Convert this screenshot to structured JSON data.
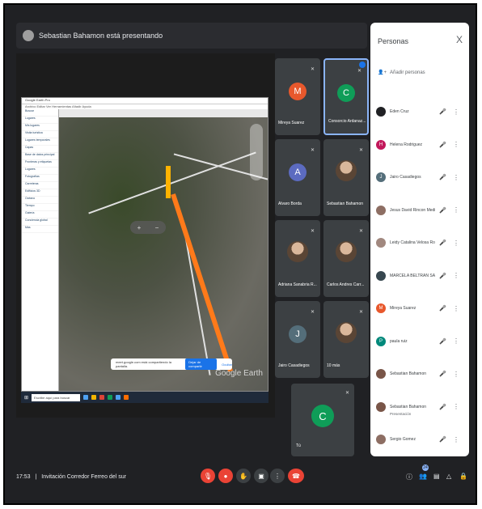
{
  "presenting": {
    "text": "Sebastian Bahamon está presentando"
  },
  "shared_screen": {
    "window_title": "Google Earth Pro",
    "menu": "Archivo  Editar  Ver  Herramientas  Añadir  Ayuda",
    "sidebar_rows": [
      "Buscar",
      "Lugares",
      "Mis lugares",
      "Visita turística",
      "Lugares temporales",
      "Capas",
      "Base de datos principal",
      "Fronteras y etiquetas",
      "Lugares",
      "Fotografías",
      "Carreteras",
      "Edificios 3D",
      "Océano",
      "Tiempo",
      "Galería",
      "Conciencia global",
      "Más"
    ],
    "map_logo": "Google Earth",
    "share_notice": "meet.google.com está compartiendo la pantalla.",
    "stop_share": "Dejar de compartir",
    "hide": "Ocultar",
    "taskbar_search": "Escribe aquí para buscar"
  },
  "tiles": [
    {
      "name": "Mireya Suarez",
      "initial": "M",
      "color": "#e8582c"
    },
    {
      "name": "Consorcio Ardanaz...",
      "initial": "C",
      "color": "#0f9d58"
    },
    {
      "name": "Alvaro Borda",
      "initial": "A",
      "color": "#5c6bc0"
    },
    {
      "name": "Sebastian Bahamon",
      "initial": "",
      "color": ""
    },
    {
      "name": "Adriana Sanabria R...",
      "initial": "",
      "color": ""
    },
    {
      "name": "Carlos Andres Carr...",
      "initial": "",
      "color": ""
    },
    {
      "name": "Jairo Casadiegos",
      "initial": "J",
      "color": "#546e7a"
    },
    {
      "name": "10 más",
      "initial": "",
      "color": ""
    }
  ],
  "self_tile": {
    "name": "Tú",
    "initial": "C",
    "color": "#0f9d58"
  },
  "people_panel": {
    "title": "Personas",
    "close": "X",
    "add_people": "Añadir personas",
    "people": [
      {
        "name": "Eden Cruz",
        "initial": "",
        "color": "#202124",
        "sub": ""
      },
      {
        "name": "Helena Rodriguez",
        "initial": "H",
        "color": "#c2185b",
        "sub": ""
      },
      {
        "name": "Jairo Casadiegos",
        "initial": "J",
        "color": "#546e7a",
        "sub": ""
      },
      {
        "name": "Jesus David Rincon Medina",
        "initial": "",
        "color": "#8d6e63",
        "sub": ""
      },
      {
        "name": "Leidy Catalina Velosa Rod...",
        "initial": "",
        "color": "#a1887f",
        "sub": ""
      },
      {
        "name": "MARCELA BELTRAN SAR...",
        "initial": "",
        "color": "#37474f",
        "sub": ""
      },
      {
        "name": "Mireya Suarez",
        "initial": "M",
        "color": "#e8582c",
        "sub": ""
      },
      {
        "name": "paula ruiz",
        "initial": "P",
        "color": "#00897b",
        "sub": ""
      },
      {
        "name": "Sebastian Bahamon",
        "initial": "",
        "color": "#795548",
        "sub": ""
      },
      {
        "name": "Sebastian Bahamon",
        "initial": "",
        "color": "#795548",
        "sub": "Presentación"
      },
      {
        "name": "Sergio Gomez",
        "initial": "",
        "color": "#8d6e63",
        "sub": ""
      }
    ]
  },
  "bottom_bar": {
    "time": "17:53",
    "separator": "|",
    "meeting": "Invitación Corredor Ferreo del sur",
    "people_count": "24"
  }
}
